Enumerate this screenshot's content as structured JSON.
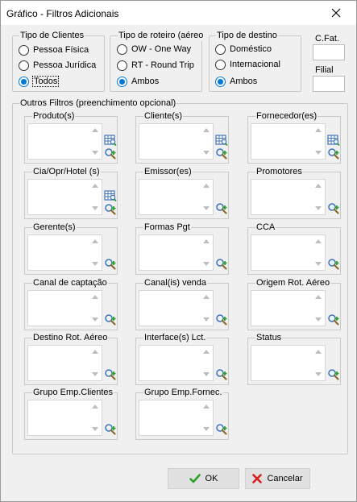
{
  "window": {
    "title": "Gráfico - Filtros Adicionais"
  },
  "tipo_clientes": {
    "label": "Tipo de Clientes",
    "options": [
      {
        "label": "Pessoa Física",
        "checked": false
      },
      {
        "label": "Pessoa Jurídica",
        "checked": false
      },
      {
        "label": "Todos",
        "checked": true
      }
    ]
  },
  "tipo_roteiro": {
    "label": "Tipo de roteiro (aéreo",
    "options": [
      {
        "label": "OW - One Way",
        "checked": false
      },
      {
        "label": "RT - Round Trip",
        "checked": false
      },
      {
        "label": "Ambos",
        "checked": true
      }
    ]
  },
  "tipo_destino": {
    "label": "Tipo de destino",
    "options": [
      {
        "label": "Doméstico",
        "checked": false
      },
      {
        "label": "Internacional",
        "checked": false
      },
      {
        "label": "Ambos",
        "checked": true
      }
    ]
  },
  "cfat": {
    "label": "C.Fat.",
    "value": ""
  },
  "filial": {
    "label": "Filial",
    "value": ""
  },
  "outros": {
    "label": "Outros Filtros (preenchimento opcional)",
    "filters": [
      {
        "label": "Produto(s)"
      },
      {
        "label": "Cliente(s)"
      },
      {
        "label": "Fornecedor(es)"
      },
      {
        "label": "Cia/Opr/Hotel (s)"
      },
      {
        "label": "Emissor(es)"
      },
      {
        "label": "Promotores"
      },
      {
        "label": "Gerente(s)"
      },
      {
        "label": "Formas Pgt"
      },
      {
        "label": "CCA"
      },
      {
        "label": "Canal de captação"
      },
      {
        "label": "Canal(is) venda"
      },
      {
        "label": "Origem Rot. Aéreo"
      },
      {
        "label": "Destino Rot. Aéreo"
      },
      {
        "label": "Interface(s) Lct."
      },
      {
        "label": "Status"
      },
      {
        "label": "Grupo Emp.Clientes"
      },
      {
        "label": "Grupo Emp.Fornec."
      }
    ]
  },
  "buttons": {
    "ok": "OK",
    "cancel": "Cancelar"
  },
  "colors": {
    "accent": "#0078d7",
    "ok_check": "#2e9e2e",
    "cancel_x": "#d81e1e"
  }
}
